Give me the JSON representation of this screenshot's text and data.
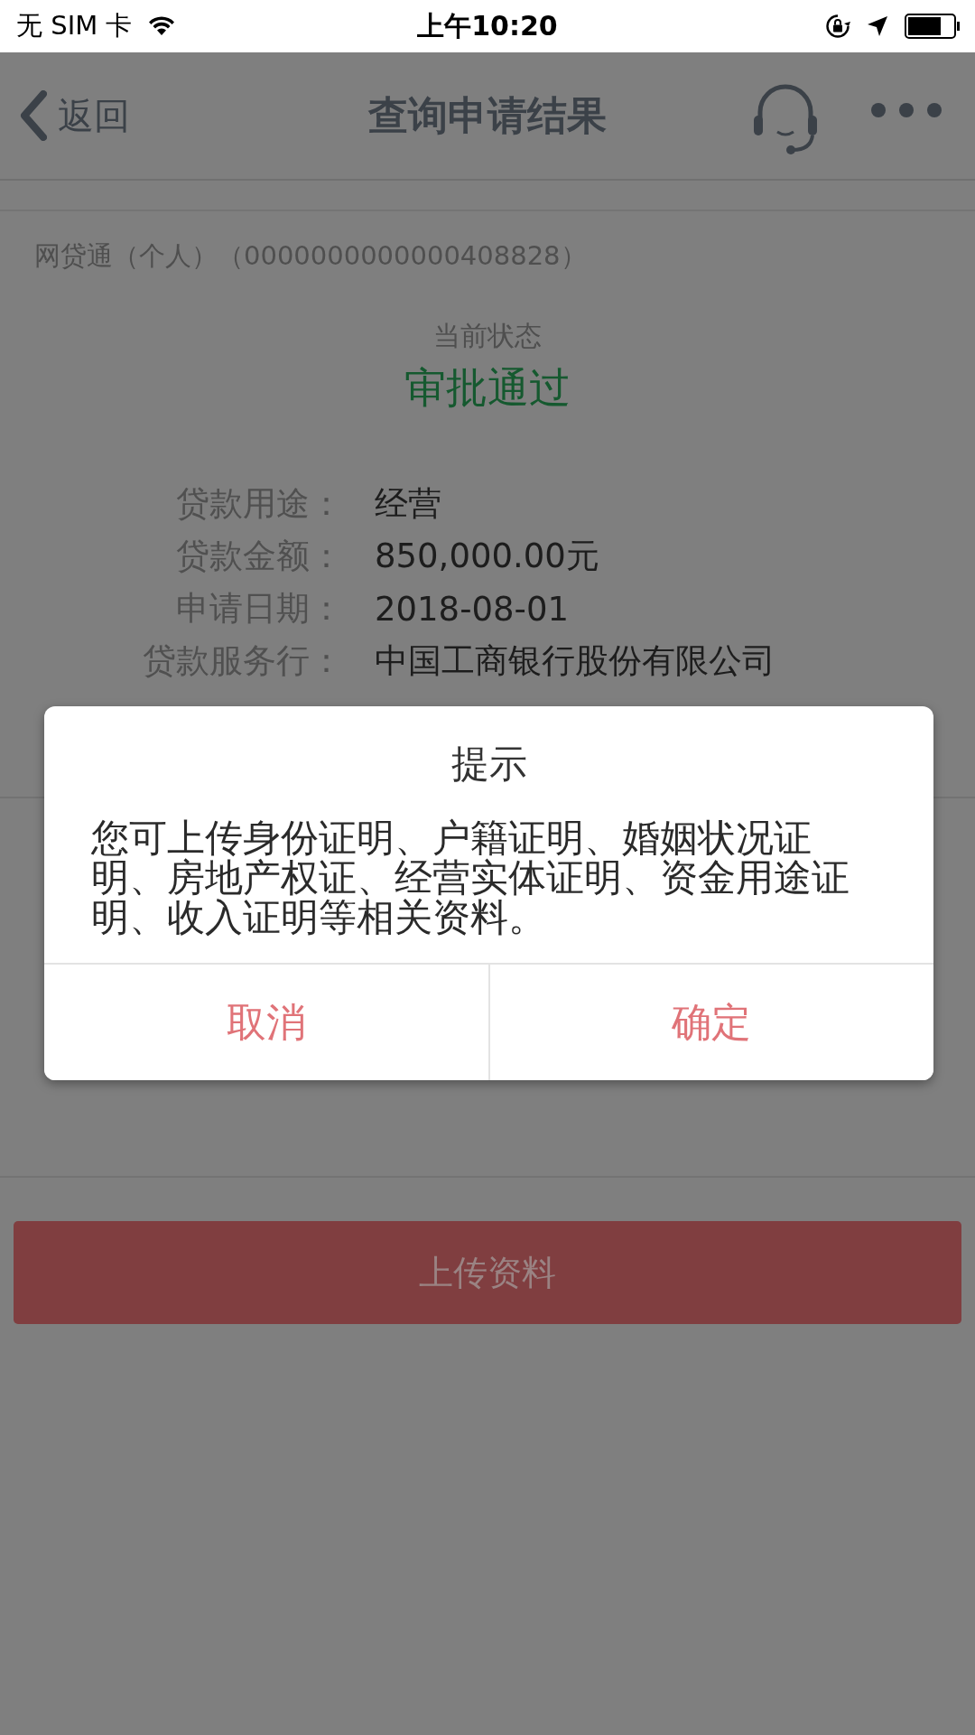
{
  "status_bar": {
    "carrier": "无 SIM 卡",
    "time": "上午10:20"
  },
  "nav_bar": {
    "back": "返回",
    "title": "查询申请结果"
  },
  "product": "网贷通（个人）（0000000000000408828）",
  "status": {
    "label": "当前状态",
    "value": "审批通过"
  },
  "details": [
    {
      "label": "贷款用途：",
      "value": "经营"
    },
    {
      "label": "贷款金额：",
      "value": "850,000.00元"
    },
    {
      "label": "申请日期：",
      "value": "2018-08-01"
    },
    {
      "label": "贷款服务行：",
      "value": "中国工商银行股份有限公司"
    }
  ],
  "upload_button": "上传资料",
  "dialog": {
    "title": "提示",
    "message": "您可上传身份证明、户籍证明、婚姻状况证明、房地产权证、经营实体证明、资金用途证明、收入证明等相关资料。",
    "buttons": [
      "取消",
      "确定"
    ]
  }
}
